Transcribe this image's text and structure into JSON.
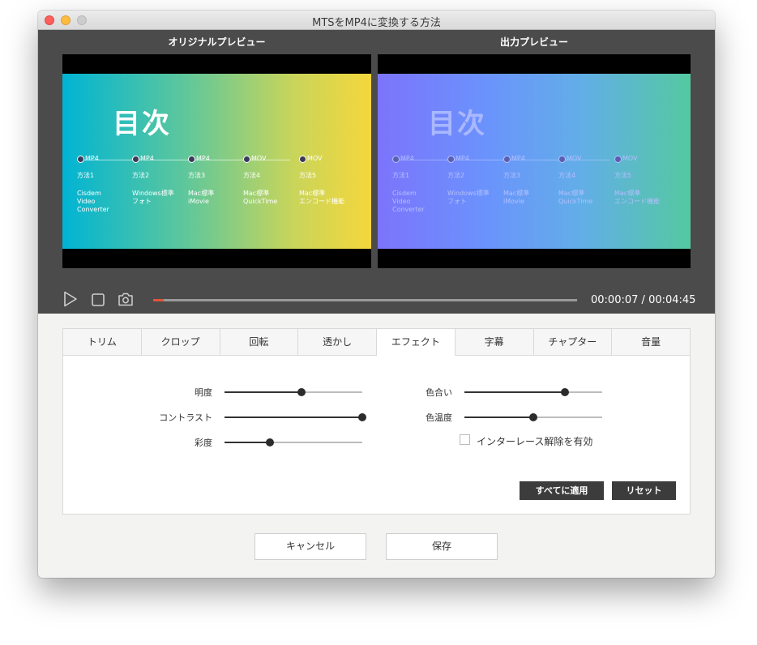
{
  "window": {
    "title": "MTSをMP4に変換する方法"
  },
  "preview": {
    "original_label": "オリジナルプレビュー",
    "output_label": "出力プレビュー",
    "slide_title": "目次",
    "steps": [
      {
        "tag": "MP4",
        "method": "方法1",
        "desc": "Cisdem\nVideo\nConverter"
      },
      {
        "tag": "MP4",
        "method": "方法2",
        "desc": "Windows標準\nフォト"
      },
      {
        "tag": "MP4",
        "method": "方法3",
        "desc": "Mac標準\niMovie"
      },
      {
        "tag": "MOV",
        "method": "方法4",
        "desc": "Mac標準\nQuickTime"
      },
      {
        "tag": "MOV",
        "method": "方法5",
        "desc": "Mac標準\nエンコード機能"
      }
    ]
  },
  "player": {
    "current_time": "00:00:07",
    "separator": "/",
    "total_time": "00:04:45",
    "progress": 0.025,
    "icons": [
      "play-icon",
      "stop-icon",
      "camera-icon"
    ]
  },
  "tabs": [
    "トリム",
    "クロップ",
    "回転",
    "透かし",
    "エフェクト",
    "字幕",
    "チャプター",
    "音量"
  ],
  "active_tab": "エフェクト",
  "effects": {
    "brightness": {
      "label": "明度",
      "value": 0.56
    },
    "contrast": {
      "label": "コントラスト",
      "value": 1.0
    },
    "saturation": {
      "label": "彩度",
      "value": 0.33
    },
    "hue": {
      "label": "色合い",
      "value": 0.73
    },
    "temperature": {
      "label": "色温度",
      "value": 0.5
    },
    "deinterlace": {
      "label": "インターレース解除を有効",
      "checked": false
    },
    "apply_all_label": "すべてに適用",
    "reset_label": "リセット"
  },
  "footer": {
    "cancel_label": "キャンセル",
    "save_label": "保存"
  },
  "colors": {
    "accent": "#e0543a",
    "dark_button": "#3c3c3c",
    "preview_bg": "#4b4b4b"
  }
}
